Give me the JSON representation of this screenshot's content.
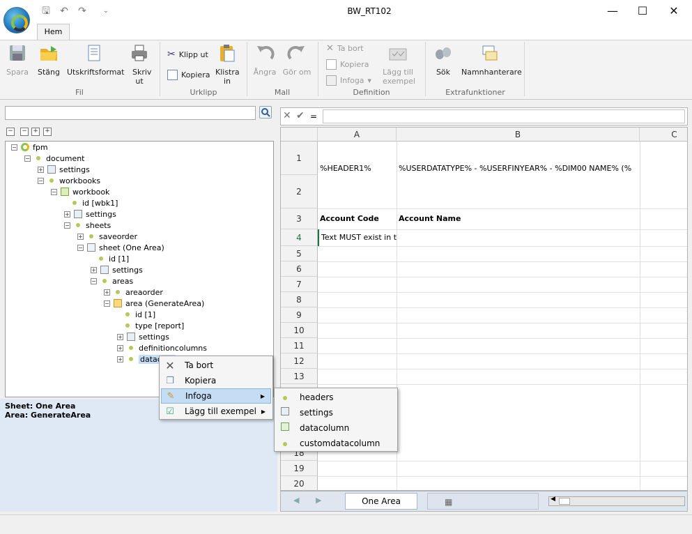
{
  "window": {
    "title": "BW_RT102",
    "minimize": "—",
    "maximize": "☐",
    "close": "✕"
  },
  "quickaccess": {
    "save": "🖫",
    "undo": "↶",
    "redo": "↷",
    "more": "⌄"
  },
  "ribbon": {
    "tab": "Hem",
    "fil": {
      "label": "Fil",
      "spara": "Spara",
      "stang": "Stäng",
      "utskrift": "Utskriftsformat",
      "skriv_ut": "Skriv ut"
    },
    "urklipp": {
      "label": "Urklipp",
      "klipp_ut": "Klipp ut",
      "kopiera": "Kopiera",
      "klistra_in": "Klistra in"
    },
    "mall": {
      "label": "Mall",
      "angra": "Ångra",
      "gor_om": "Gör om"
    },
    "definition": {
      "label": "Definition",
      "ta_bort": "Ta bort",
      "kopiera": "Kopiera",
      "infoga": "Infoga",
      "lagg_till": "Lägg till exempel"
    },
    "extra": {
      "label": "Extrafunktioner",
      "sok": "Sök",
      "namnhanterare": "Namnhanterare"
    }
  },
  "tree": {
    "fpm": "fpm",
    "document": "document",
    "settings1": "settings",
    "workbooks": "workbooks",
    "workbook": "workbook",
    "id_wbk": "id [wbk1]",
    "settings2": "settings",
    "sheets": "sheets",
    "saveorder": "saveorder",
    "sheet": "sheet (One Area)",
    "id1": "id [1]",
    "settings3": "settings",
    "areas": "areas",
    "areaorder": "areaorder",
    "area": "area (GenerateArea)",
    "id2": "id [1]",
    "type": "type [report]",
    "settings4": "settings",
    "definitioncolumns": "definitioncolumns",
    "datacolumns": "datac"
  },
  "info": {
    "sheet": "Sheet: One Area",
    "area": "Area: GenerateArea"
  },
  "formula": {
    "cancel": "✕",
    "accept": "✔",
    "eq": "="
  },
  "grid": {
    "cols": [
      "A",
      "B",
      "C"
    ],
    "rows": [
      "1",
      "2",
      "3",
      "4",
      "5",
      "6",
      "7",
      "8",
      "9",
      "10",
      "11",
      "12",
      "13",
      "18",
      "19",
      "20"
    ],
    "a2": "%HEADER1%",
    "b2": "%USERDATATYPE%   - %USERFINYEAR% - %DIM00 NAME%  (%",
    "a3": "Account Code",
    "b3": "Account Name",
    "a4": "Text MUST exist in th"
  },
  "sheetbar": {
    "tab": "One Area"
  },
  "context_menu": {
    "items": [
      "Ta bort",
      "Kopiera",
      "Infoga",
      "Lägg till exempel"
    ]
  },
  "submenu": {
    "items": [
      "headers",
      "settings",
      "datacolumn",
      "customdatacolumn"
    ]
  }
}
